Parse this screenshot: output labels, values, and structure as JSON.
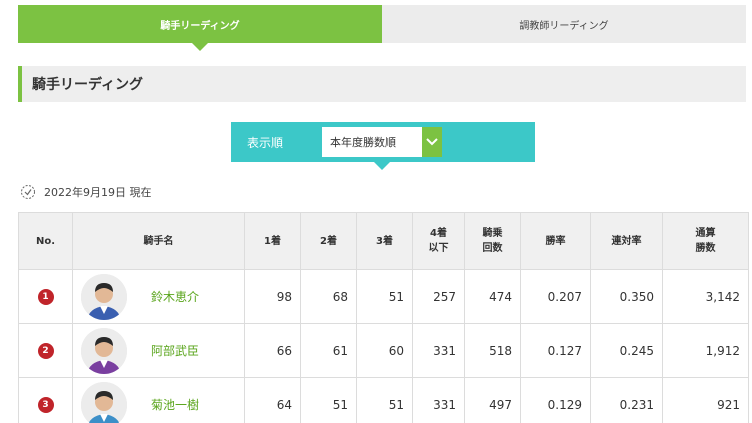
{
  "tabs": [
    {
      "label": "騎手リーディング",
      "active": true
    },
    {
      "label": "調教師リーディング",
      "active": false
    }
  ],
  "section_title": "騎手リーディング",
  "sort": {
    "label": "表示順",
    "selected": "本年度勝数順"
  },
  "date_text": "2022年9月19日 現在",
  "table": {
    "headers": [
      "No.",
      "騎手名",
      "1着",
      "2着",
      "3着",
      "4着\n以下",
      "騎乗\n回数",
      "勝率",
      "連対率",
      "通算\n勝数"
    ],
    "rows": [
      {
        "rank": "1",
        "name": "鈴木恵介",
        "first": "98",
        "second": "68",
        "third": "51",
        "fourth_below": "257",
        "rides": "474",
        "win_rate": "0.207",
        "quinella_rate": "0.350",
        "total_wins": "3,142",
        "silk": "#3a5fb0"
      },
      {
        "rank": "2",
        "name": "阿部武臣",
        "first": "66",
        "second": "61",
        "third": "60",
        "fourth_below": "331",
        "rides": "518",
        "win_rate": "0.127",
        "quinella_rate": "0.245",
        "total_wins": "1,912",
        "silk": "#7a3fa0"
      },
      {
        "rank": "3",
        "name": "菊池一樹",
        "first": "64",
        "second": "51",
        "third": "51",
        "fourth_below": "331",
        "rides": "497",
        "win_rate": "0.129",
        "quinella_rate": "0.231",
        "total_wins": "921",
        "silk": "#3c8fc8"
      }
    ]
  },
  "colors": {
    "accent_green": "#7cc242",
    "accent_teal": "#3cc8c8",
    "rank_red": "#c0242a",
    "name_green": "#5aa51c"
  }
}
